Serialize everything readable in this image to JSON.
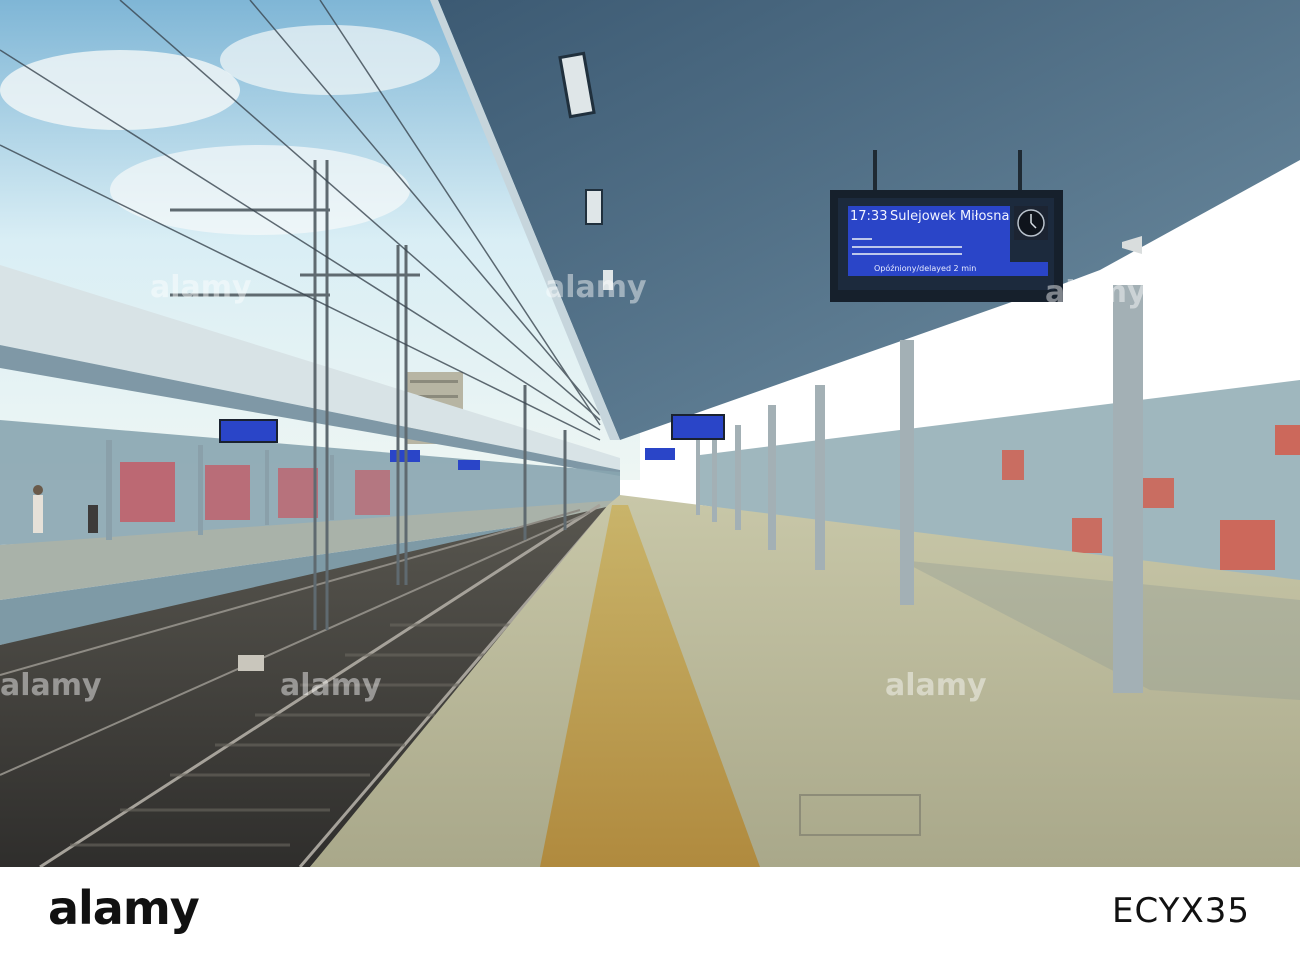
{
  "image": {
    "kind": "photo",
    "subject": "empty railway station platform under a long canopy with a departure display board"
  },
  "departure_board": {
    "time": "17:33",
    "destination": "Sulejowek Miłosna",
    "status": "Opóźniony/delayed 2 min"
  },
  "watermarks": [
    "alamy",
    "alamy",
    "alamy",
    "alamy",
    "alamy",
    "alamy"
  ],
  "footer": {
    "logo": "alamy",
    "image_code": "ECYX35"
  },
  "colors": {
    "board_blue": "#2a45c8",
    "sky": "#cfe6f2",
    "platform": "#b7b89a",
    "canopy": "#4f6f86",
    "track": "#3d3c3a"
  }
}
